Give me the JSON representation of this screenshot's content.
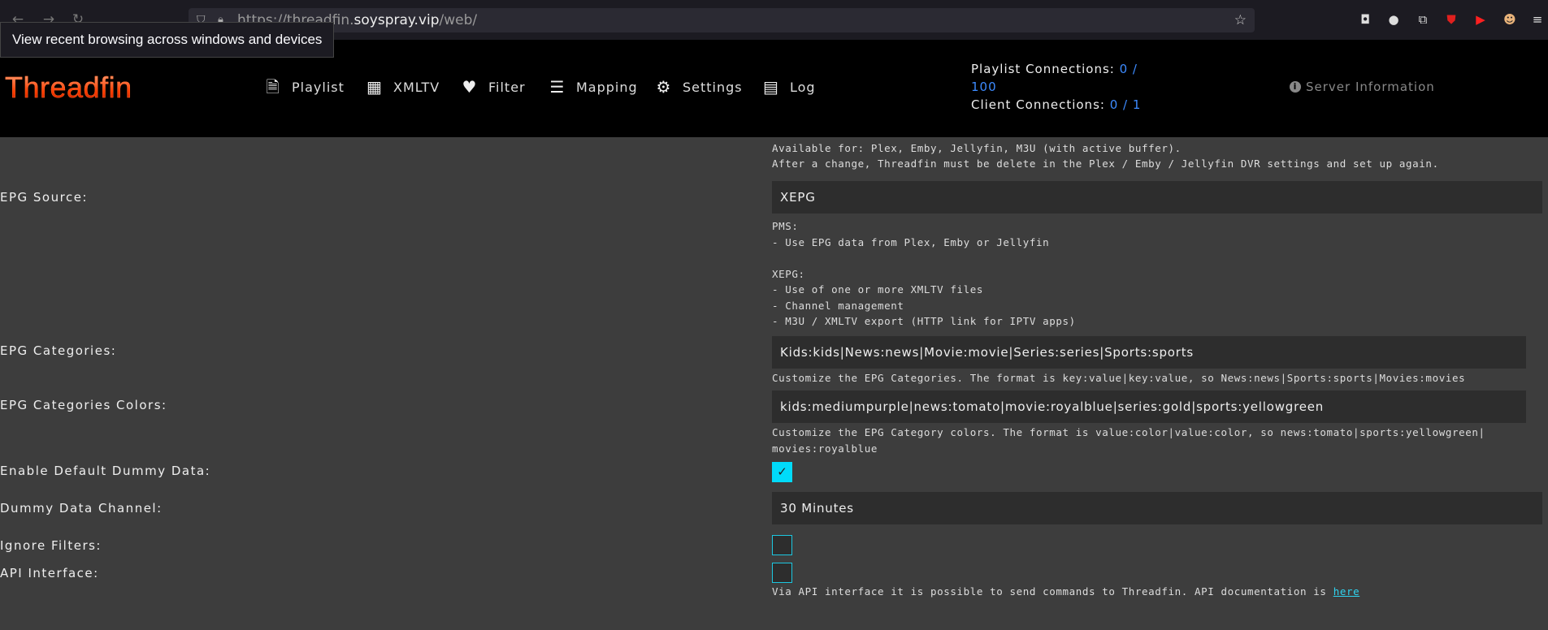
{
  "browser": {
    "url_prefix": "https://threadfin.",
    "url_host": "soyspray.vip",
    "url_path": "/web/",
    "tooltip": "View recent browsing across windows and devices"
  },
  "app": {
    "logo": "Threadfin",
    "menu": [
      "Playlist",
      "XMLTV",
      "Filter",
      "Mapping",
      "Settings",
      "Log"
    ],
    "playlist_connections_label": "Playlist Connections:",
    "playlist_connections_value_a": "0 /",
    "playlist_connections_value_b": "100",
    "client_connections_label": "Client Connections:",
    "client_connections_value": "0 / 1",
    "server_info": "Server Information"
  },
  "settings": {
    "top_desc_line1": "Available for: Plex, Emby, Jellyfin, M3U (with active buffer).",
    "top_desc_line2": "After a change, Threadfin must be delete in the Plex / Emby / Jellyfin DVR settings and set up again.",
    "epg_source_label": "EPG Source:",
    "epg_source_value": "XEPG",
    "epg_source_desc": "PMS:\n- Use EPG data from Plex, Emby or Jellyfin\n\nXEPG:\n- Use of one or more XMLTV files\n- Channel management\n- M3U / XMLTV export (HTTP link for IPTV apps)",
    "epg_categories_label": "EPG Categories:",
    "epg_categories_value": "Kids:kids|News:news|Movie:movie|Series:series|Sports:sports",
    "epg_categories_desc": "Customize the EPG Categories. The format is key:value|key:value, so News:news|Sports:sports|Movies:movies",
    "epg_colors_label": "EPG Categories Colors:",
    "epg_colors_value": "kids:mediumpurple|news:tomato|movie:royalblue|series:gold|sports:yellowgreen",
    "epg_colors_desc": "Customize the EPG Category colors. The format is value:color|value:color, so news:tomato|sports:yellowgreen|\nmovies:royalblue",
    "dummy_data_label": "Enable Default Dummy Data:",
    "dummy_data_checked": true,
    "dummy_channel_label": "Dummy Data Channel:",
    "dummy_channel_value": "30 Minutes",
    "ignore_filters_label": "Ignore Filters:",
    "ignore_filters_checked": false,
    "api_label": "API Interface:",
    "api_checked": false,
    "api_desc": "Via API interface it is possible to send commands to Threadfin. API documentation is ",
    "api_link": "here"
  },
  "colors": {
    "accent": "#00dbfa",
    "link": "#3d8bff",
    "header_bg": "#000000",
    "content_bg": "#3d3d3d"
  }
}
